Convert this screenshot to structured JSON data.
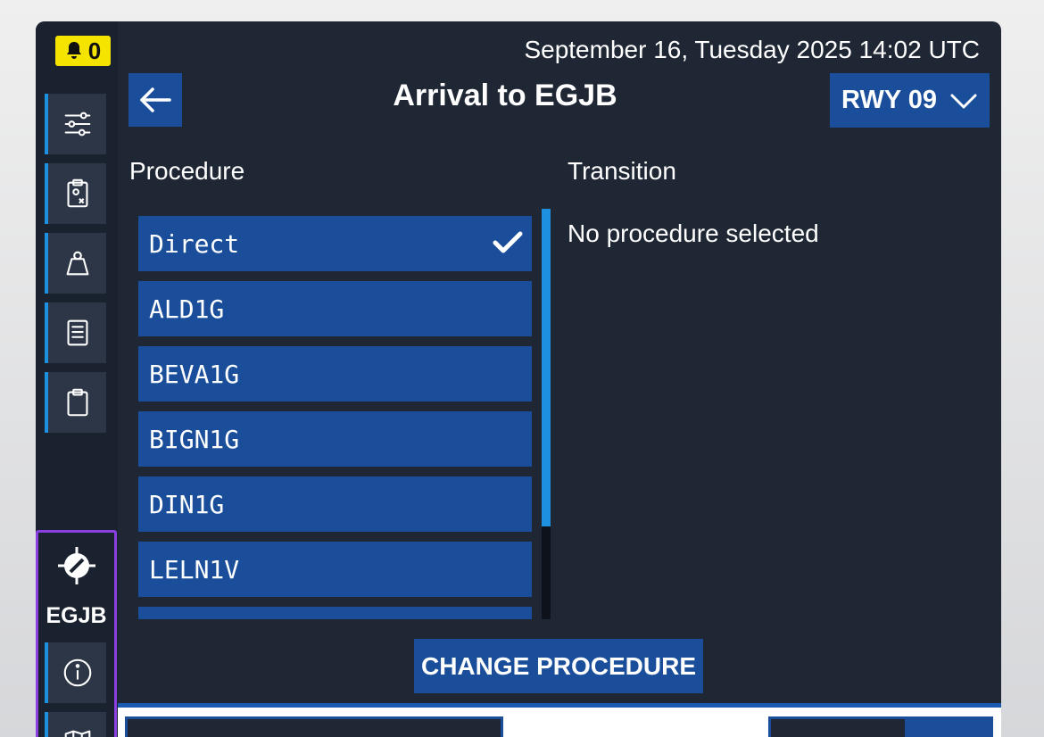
{
  "header": {
    "notification_count": "0",
    "datetime": "September 16, Tuesday 2025 14:02 UTC",
    "title": "Arrival to EGJB",
    "runway_label": "RWY 09"
  },
  "sidebar": {
    "items": [
      {
        "icon": "sliders-icon"
      },
      {
        "icon": "clipboard-x-icon"
      },
      {
        "icon": "weight-icon"
      },
      {
        "icon": "document-list-icon"
      },
      {
        "icon": "clipboard-icon"
      }
    ],
    "airport": {
      "code": "EGJB",
      "icon": "airport-icon",
      "items": [
        {
          "icon": "info-icon"
        },
        {
          "icon": "map-icon"
        }
      ]
    }
  },
  "procedure": {
    "label": "Procedure",
    "items": [
      {
        "name": "Direct",
        "selected": true
      },
      {
        "name": "ALD1G",
        "selected": false
      },
      {
        "name": "BEVA1G",
        "selected": false
      },
      {
        "name": "BIGN1G",
        "selected": false
      },
      {
        "name": "DIN1G",
        "selected": false
      },
      {
        "name": "LELN1V",
        "selected": false
      }
    ]
  },
  "transition": {
    "label": "Transition",
    "empty_text": "No procedure selected"
  },
  "actions": {
    "change_procedure": "CHANGE PROCEDURE"
  },
  "colors": {
    "accent": "#1a4e9a",
    "highlight": "#1e90e0",
    "background": "#1f2734",
    "airport_border": "#8a3fe0",
    "notification": "#f5e400"
  }
}
